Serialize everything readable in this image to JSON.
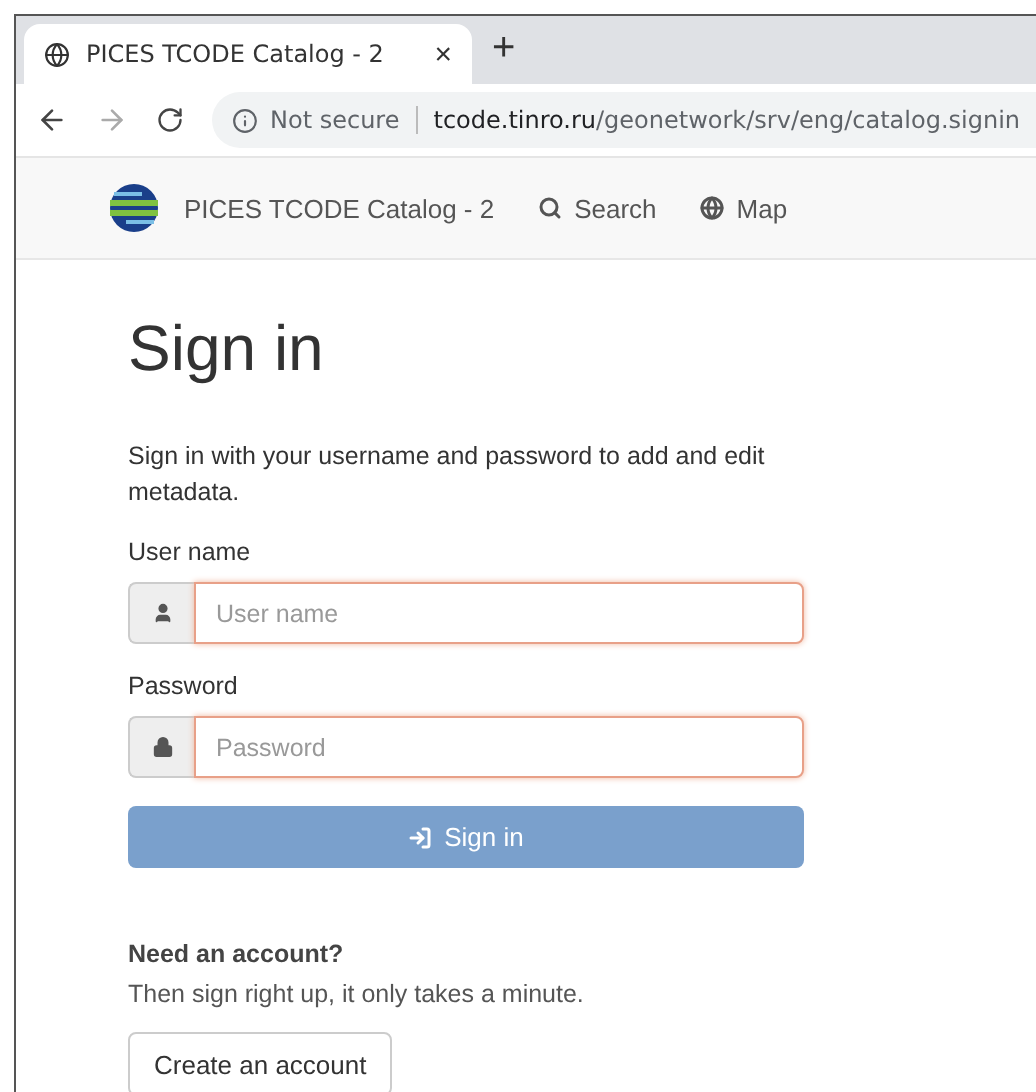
{
  "browser": {
    "tab": {
      "title": "PICES TCODE Catalog - 2",
      "close": "×"
    },
    "new_tab": "+",
    "security": "Not secure",
    "url_host": "tcode.tinro.ru",
    "url_path": "/geonetwork/srv/eng/catalog.signin"
  },
  "navbar": {
    "brand": "PICES TCODE Catalog - 2",
    "links": [
      {
        "kind": "search",
        "label": "Search"
      },
      {
        "kind": "map",
        "label": "Map"
      }
    ]
  },
  "title": "Sign in",
  "intro": "Sign in with your username and password to add and edit metadata.",
  "fields": [
    {
      "kind": "user",
      "label": "User name",
      "placeholder": "User name",
      "invalid": true
    },
    {
      "kind": "lock",
      "label": "Password",
      "placeholder": "Password",
      "invalid": true
    }
  ],
  "sign_in_button": {
    "label": "Sign in",
    "disabled": true
  },
  "account": {
    "heading": "Need an account?",
    "text": "Then sign right up, it only takes a minute.",
    "button": "Create an account"
  }
}
